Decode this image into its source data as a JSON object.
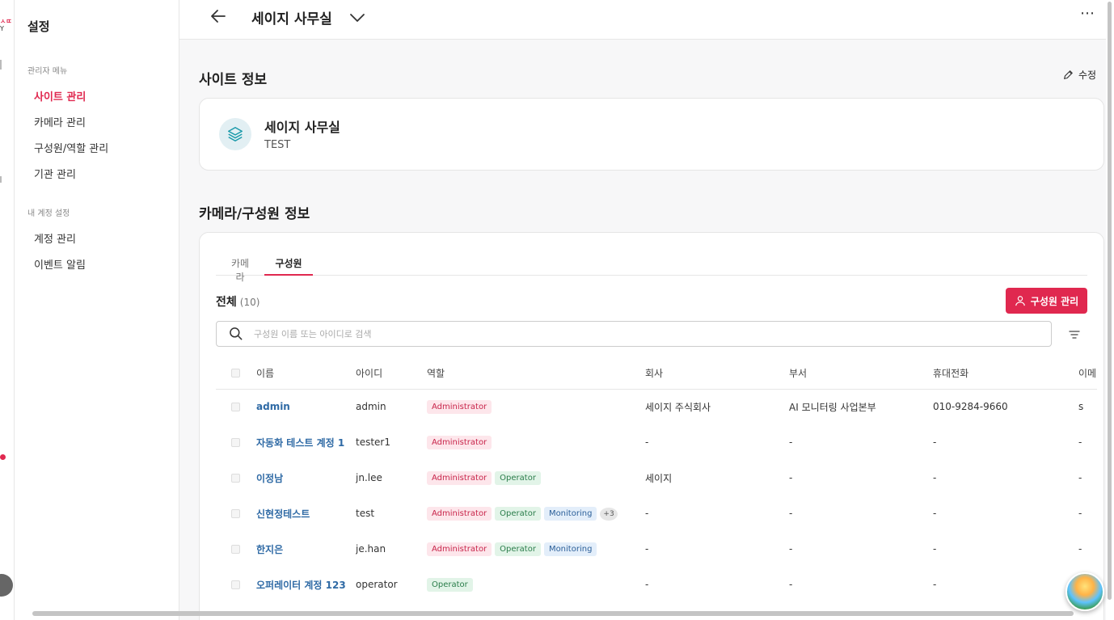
{
  "rail": {
    "logo_line1": "ㅅㄸ",
    "logo_line2": "Y"
  },
  "sidebar": {
    "title": "설정",
    "sections": [
      {
        "label": "관리자 메뉴",
        "items": [
          "사이트 관리",
          "카메라 관리",
          "구성원/역할 관리",
          "기관 관리"
        ]
      },
      {
        "label": "내 계정 설정",
        "items": [
          "계정 관리",
          "이벤트 알림"
        ]
      }
    ],
    "active_item": "사이트 관리"
  },
  "header": {
    "site_name": "세이지 사무실",
    "more": "⋯"
  },
  "site_info": {
    "title": "사이트 정보",
    "edit_label": "수정",
    "name": "세이지 사무실",
    "description": "TEST",
    "icon": "layers-icon"
  },
  "members_section": {
    "title": "카메라/구성원 정보",
    "tabs": [
      "카메라",
      "구성원"
    ],
    "active_tab": "구성원",
    "count_label": "전체",
    "count_value": "(10)",
    "manage_button": "구성원 관리",
    "search_placeholder": "구성원 이름 또는 아이디로 검색",
    "columns": [
      "이름",
      "아이디",
      "역할",
      "회사",
      "부서",
      "휴대전화",
      "이메일"
    ],
    "rows": [
      {
        "name": "admin",
        "id": "admin",
        "roles": [
          "Administrator"
        ],
        "more": "",
        "company": "세이지 주식회사",
        "dept": "AI 모니터링 사업본부",
        "phone": "010-9284-9660",
        "email": "s"
      },
      {
        "name": "자동화 테스트 계정 1",
        "id": "tester1",
        "roles": [
          "Administrator"
        ],
        "more": "",
        "company": "-",
        "dept": "-",
        "phone": "-",
        "email": "-"
      },
      {
        "name": "이정남",
        "id": "jn.lee",
        "roles": [
          "Administrator",
          "Operator"
        ],
        "more": "",
        "company": "세이지",
        "dept": "-",
        "phone": "-",
        "email": "-"
      },
      {
        "name": "신현정테스트",
        "id": "test",
        "roles": [
          "Administrator",
          "Operator",
          "Monitoring"
        ],
        "more": "+3",
        "company": "-",
        "dept": "-",
        "phone": "-",
        "email": "-"
      },
      {
        "name": "한지은",
        "id": "je.han",
        "roles": [
          "Administrator",
          "Operator",
          "Monitoring"
        ],
        "more": "",
        "company": "-",
        "dept": "-",
        "phone": "-",
        "email": "-"
      },
      {
        "name": "오퍼레이터 계정 123",
        "id": "operator",
        "roles": [
          "Operator"
        ],
        "more": "",
        "company": "-",
        "dept": "-",
        "phone": "-",
        "email": "-"
      }
    ]
  },
  "colors": {
    "accent": "#e0284f",
    "link": "#2f6aa5"
  }
}
